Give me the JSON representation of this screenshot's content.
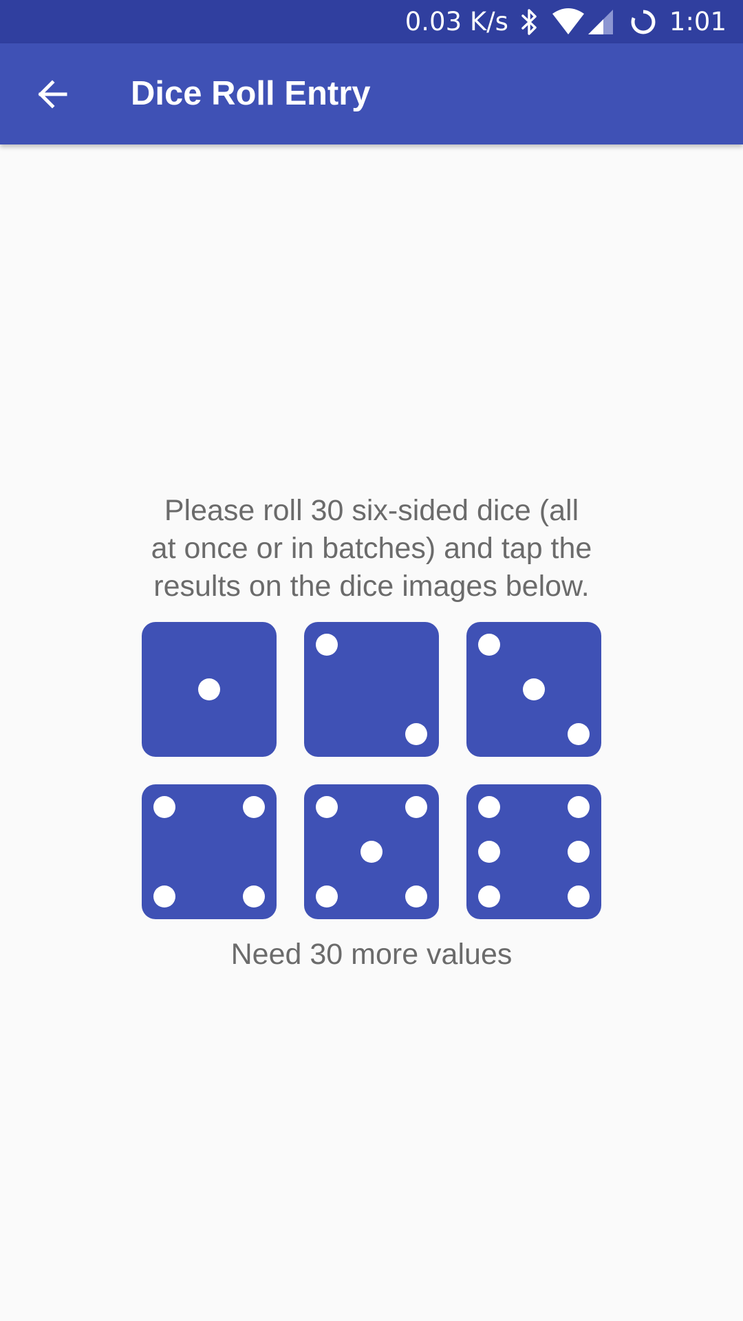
{
  "colors": {
    "status_bar": "#303f9f",
    "app_bar": "#3f51b5",
    "die": "#3f51b5",
    "pip": "#ffffff",
    "text": "#6b6b6b",
    "background": "#fafafa"
  },
  "status_bar": {
    "network_speed": "0.03 K/s",
    "time": "1:01",
    "icons": [
      "bluetooth-icon",
      "wifi-icon",
      "cell-signal-icon",
      "sync-icon"
    ]
  },
  "app_bar": {
    "back_icon": "arrow-back-icon",
    "title": "Dice Roll Entry"
  },
  "main": {
    "instructions_line1": "Please roll 30 six-sided dice (all",
    "instructions_line2": "at once or in batches) and tap the",
    "instructions_line3": "results on the dice images below.",
    "dice": [
      {
        "value": 1
      },
      {
        "value": 2
      },
      {
        "value": 3
      },
      {
        "value": 4
      },
      {
        "value": 5
      },
      {
        "value": 6
      }
    ],
    "status": "Need 30 more values"
  }
}
